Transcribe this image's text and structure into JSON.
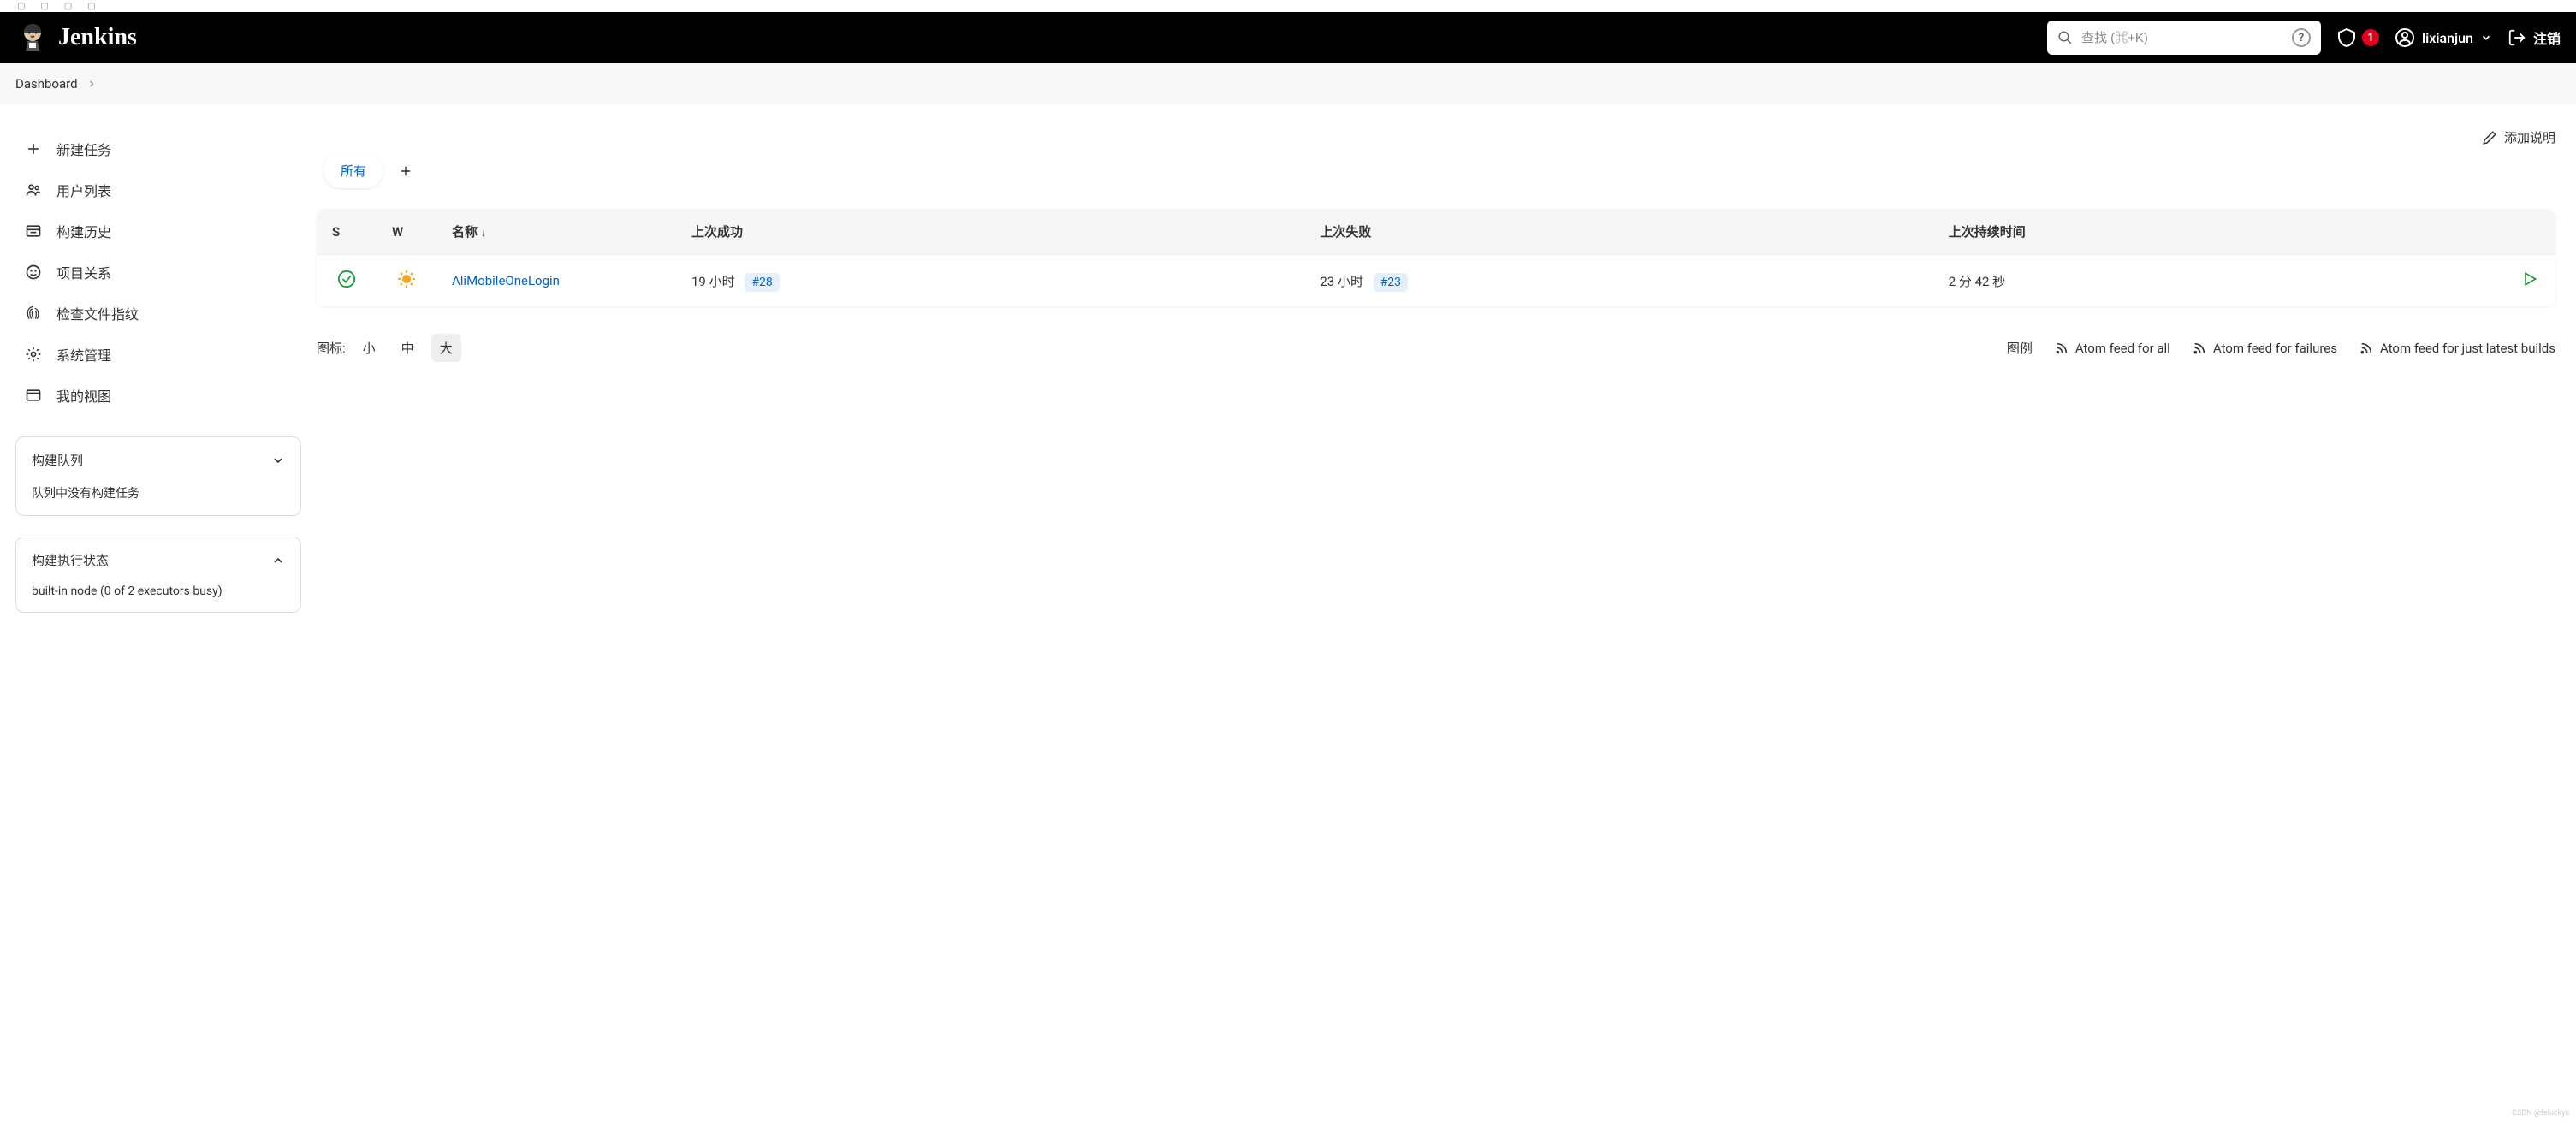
{
  "header": {
    "brand": "Jenkins",
    "search_placeholder": "查找 (⌘+K)",
    "alert_count": "1",
    "username": "lixianjun",
    "logout": "注销"
  },
  "breadcrumb": {
    "items": [
      "Dashboard"
    ]
  },
  "sidebar": {
    "nav": [
      {
        "label": "新建任务",
        "icon": "plus"
      },
      {
        "label": "用户列表",
        "icon": "people"
      },
      {
        "label": "构建历史",
        "icon": "history"
      },
      {
        "label": "项目关系",
        "icon": "smile"
      },
      {
        "label": "检查文件指纹",
        "icon": "fingerprint"
      },
      {
        "label": "系统管理",
        "icon": "gear"
      },
      {
        "label": "我的视图",
        "icon": "window"
      }
    ],
    "build_queue": {
      "title": "构建队列",
      "empty_text": "队列中没有构建任务"
    },
    "executor_status": {
      "title": "构建执行状态",
      "node_text": "built-in node (0 of 2 executors busy)"
    }
  },
  "content": {
    "add_description": "添加说明",
    "tabs": {
      "all": "所有"
    },
    "table": {
      "headers": {
        "s": "S",
        "w": "W",
        "name": "名称",
        "last_success": "上次成功",
        "last_failure": "上次失败",
        "last_duration": "上次持续时间"
      },
      "rows": [
        {
          "name": "AliMobileOneLogin",
          "last_success_time": "19 小时",
          "last_success_build": "#28",
          "last_failure_time": "23 小时",
          "last_failure_build": "#23",
          "last_duration": "2 分 42 秒"
        }
      ]
    },
    "footer": {
      "icon_size_label": "图标:",
      "sizes": {
        "small": "小",
        "medium": "中",
        "large": "大"
      },
      "legend": "图例",
      "atom_all": "Atom feed for all",
      "atom_failures": "Atom feed for failures",
      "atom_latest": "Atom feed for just latest builds"
    }
  },
  "watermark": "CSDN @feluckys"
}
